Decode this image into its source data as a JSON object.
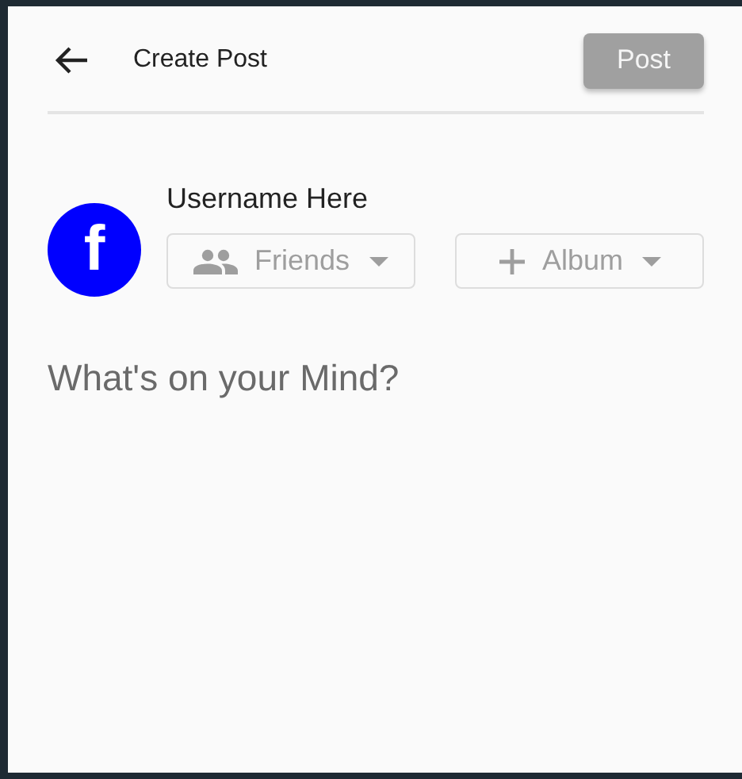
{
  "header": {
    "title": "Create Post",
    "post_button": {
      "label": "Post",
      "disabled": true
    }
  },
  "author": {
    "avatar_letter": "f",
    "name": "Username Here"
  },
  "selectors": [
    {
      "kind": "people",
      "label": "Friends"
    },
    {
      "kind": "add",
      "label": "Album"
    }
  ],
  "composer": {
    "placeholder": "What's on your Mind?"
  }
}
